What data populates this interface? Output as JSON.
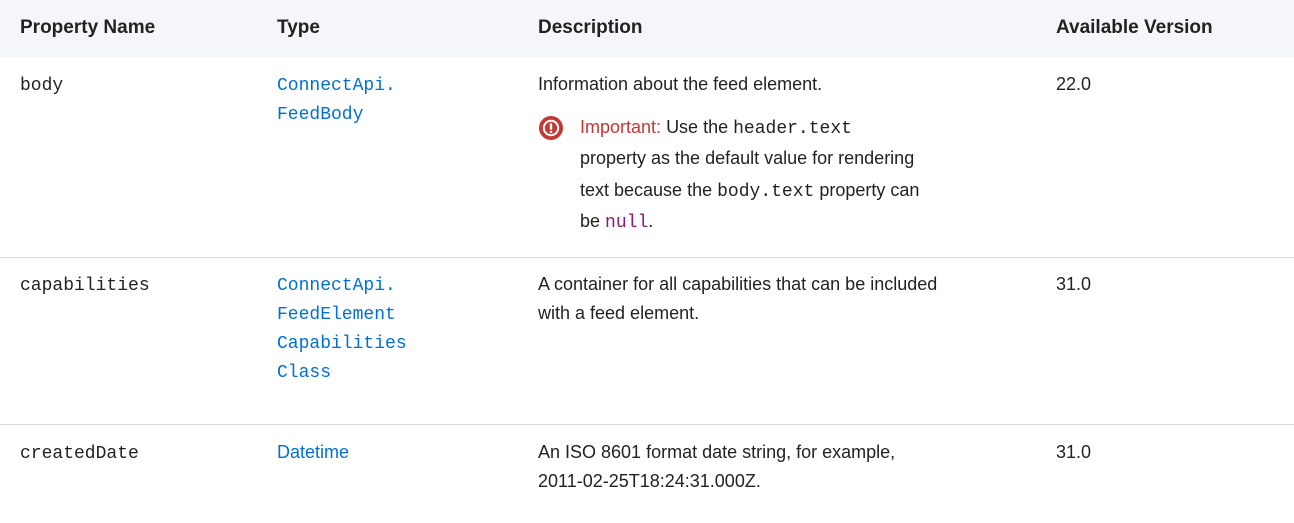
{
  "headers": {
    "property_name": "Property Name",
    "type": "Type",
    "description": "Description",
    "available_version": "Available Version"
  },
  "rows": [
    {
      "name": "body",
      "type_line1": "ConnectApi.",
      "type_line2": "FeedBody",
      "description": "Information about the feed element.",
      "version": "22.0",
      "note": {
        "label": "Important:",
        "text_1a": "Use the",
        "code_1": "header.text",
        "text_2": "property as the default value for rendering",
        "text_3a": "text because the",
        "code_2": "body.text",
        "text_3b": "property can",
        "text_4a": "be",
        "code_3": "null",
        "text_4b": "."
      }
    },
    {
      "name": "capabilities",
      "type_line1": "ConnectApi.",
      "type_line2": "FeedElement",
      "type_line3": "Capabilities",
      "type_line4": "Class",
      "description_line1": "A container for all capabilities that can be included",
      "description_line2": "with a feed element.",
      "version": "31.0"
    },
    {
      "name": "createdDate",
      "type": "Datetime",
      "description_line1": "An ISO 8601 format date string, for example,",
      "description_line2": "2011-02-25T18:24:31.000Z.",
      "version": "31.0"
    }
  ],
  "colors": {
    "header_bg": "#f4f6f9",
    "link": "#0070d2",
    "important": "#c23934",
    "code_value": "#8a1a75",
    "divider": "#d8dde6"
  }
}
